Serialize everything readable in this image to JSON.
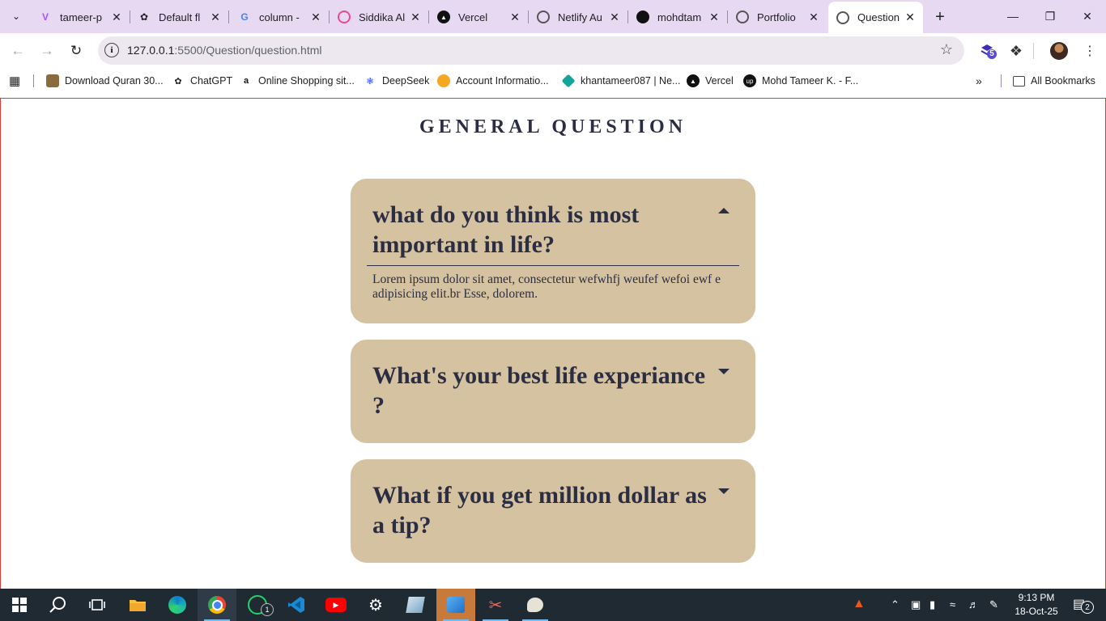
{
  "browser": {
    "tabs": [
      {
        "title": "tameer-p",
        "icon": "vite-icon"
      },
      {
        "title": "Default fl",
        "icon": "openai-icon"
      },
      {
        "title": "column -",
        "icon": "google-icon"
      },
      {
        "title": "Siddika Al",
        "icon": "dribbble-icon"
      },
      {
        "title": "Vercel",
        "icon": "vercel-icon"
      },
      {
        "title": "Netlify Au",
        "icon": "globe-icon"
      },
      {
        "title": "mohdtam",
        "icon": "github-icon"
      },
      {
        "title": "Portfolio",
        "icon": "globe-icon"
      },
      {
        "title": "Question",
        "icon": "globe-icon",
        "active": true
      }
    ],
    "url_host": "127.0.0.1",
    "url_path": ":5500/Question/question.html",
    "extension_badge": "5",
    "bookmarks": [
      {
        "label": "Download Quran 30...",
        "icon": "quran-icon"
      },
      {
        "label": "ChatGPT",
        "icon": "openai-icon"
      },
      {
        "label": "Online Shopping sit...",
        "icon": "amazon-icon"
      },
      {
        "label": "DeepSeek",
        "icon": "deepseek-icon"
      },
      {
        "label": "Account Informatio...",
        "icon": "account-icon"
      },
      {
        "label": "khantameer087 | Ne...",
        "icon": "netlify-icon"
      },
      {
        "label": "Vercel",
        "icon": "vercel-icon"
      },
      {
        "label": "Mohd Tameer K. - F...",
        "icon": "upwork-icon"
      }
    ],
    "all_bookmarks": "All Bookmarks"
  },
  "page": {
    "heading": "GENERAL QUESTION",
    "faqs": [
      {
        "question": "what do you think is most important in life?",
        "answer": "Lorem ipsum dolor sit amet, consectetur wefwhfj weufef wefoi ewf e adipisicing elit.br Esse, dolorem.",
        "expanded": true
      },
      {
        "question": "What's your best life experiance ?",
        "expanded": false
      },
      {
        "question": "What if you get million dollar as a tip?",
        "expanded": false
      }
    ]
  },
  "taskbar": {
    "time": "9:13 PM",
    "date": "18-Oct-25",
    "whatsapp_badge": "1",
    "notification_count": "2"
  },
  "colors": {
    "card": "#d5c2a0",
    "text": "#2b2d42",
    "tabstrip": "#e8d9f2",
    "border": "#e03a3a",
    "taskbar": "#1f2a33"
  }
}
